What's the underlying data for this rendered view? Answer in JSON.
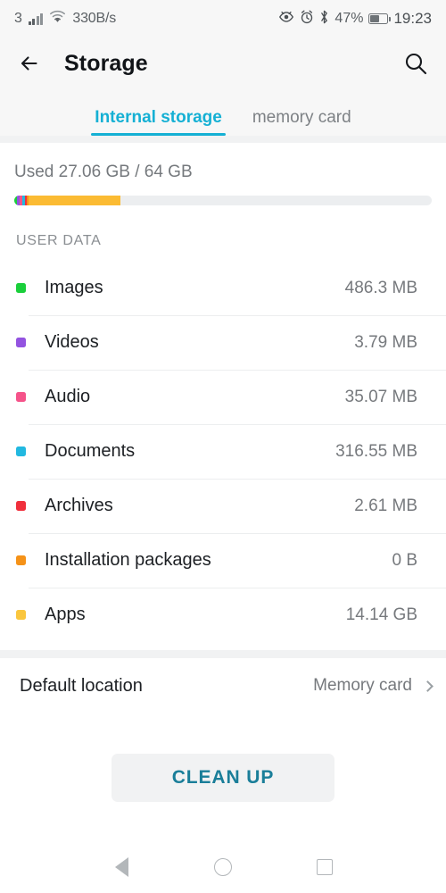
{
  "status_bar": {
    "sim_label": "3",
    "network_speed": "330B/s",
    "battery_percent": "47%",
    "clock": "19:23",
    "icons": [
      "signal-bars-icon",
      "wifi-icon",
      "eye-comfort-icon",
      "alarm-clock-icon",
      "bluetooth-icon",
      "battery-icon"
    ]
  },
  "toolbar": {
    "back_icon": "back-arrow-icon",
    "title": "Storage",
    "search_icon": "search-icon"
  },
  "tabs": [
    {
      "label": "Internal storage",
      "active": true
    },
    {
      "label": "memory card",
      "active": false
    }
  ],
  "usage": {
    "summary": "Used 27.06 GB / 64 GB",
    "used_gb": 27.06,
    "total_gb": 64,
    "track_color": "#eceef0",
    "segments": [
      {
        "name": "Images",
        "color": "#1ACF3B",
        "percent": 0.74
      },
      {
        "name": "Videos",
        "color": "#9353E0",
        "percent": 0.6
      },
      {
        "name": "Audio",
        "color": "#F5538A",
        "percent": 0.6
      },
      {
        "name": "Documents",
        "color": "#22B8E0",
        "percent": 0.6
      },
      {
        "name": "Archives",
        "color": "#F0303C",
        "percent": 0.5
      },
      {
        "name": "Installation packages",
        "color": "#F59218",
        "percent": 0.4
      },
      {
        "name": "Apps",
        "color": "#FBBB33",
        "percent": 22.1
      }
    ]
  },
  "user_data": {
    "header": "USER DATA",
    "items": [
      {
        "label": "Images",
        "size": "486.3 MB",
        "color": "#1ACF3B"
      },
      {
        "label": "Videos",
        "size": "3.79 MB",
        "color": "#9353E0"
      },
      {
        "label": "Audio",
        "size": "35.07 MB",
        "color": "#F5538A"
      },
      {
        "label": "Documents",
        "size": "316.55 MB",
        "color": "#22B8E0"
      },
      {
        "label": "Archives",
        "size": "2.61 MB",
        "color": "#F0303C"
      },
      {
        "label": "Installation packages",
        "size": "0 B",
        "color": "#F59218"
      },
      {
        "label": "Apps",
        "size": "14.14 GB",
        "color": "#FAC63E"
      }
    ]
  },
  "default_location": {
    "label": "Default location",
    "value": "Memory card",
    "chevron_icon": "chevron-right-icon"
  },
  "cleanup": {
    "label": "CLEAN UP"
  },
  "nav_bar": {
    "back": "nav-back-icon",
    "home": "nav-home-icon",
    "recents": "nav-recents-icon"
  },
  "colors": {
    "accent": "#15b0d4",
    "cleanup_text": "#1a7e99"
  }
}
